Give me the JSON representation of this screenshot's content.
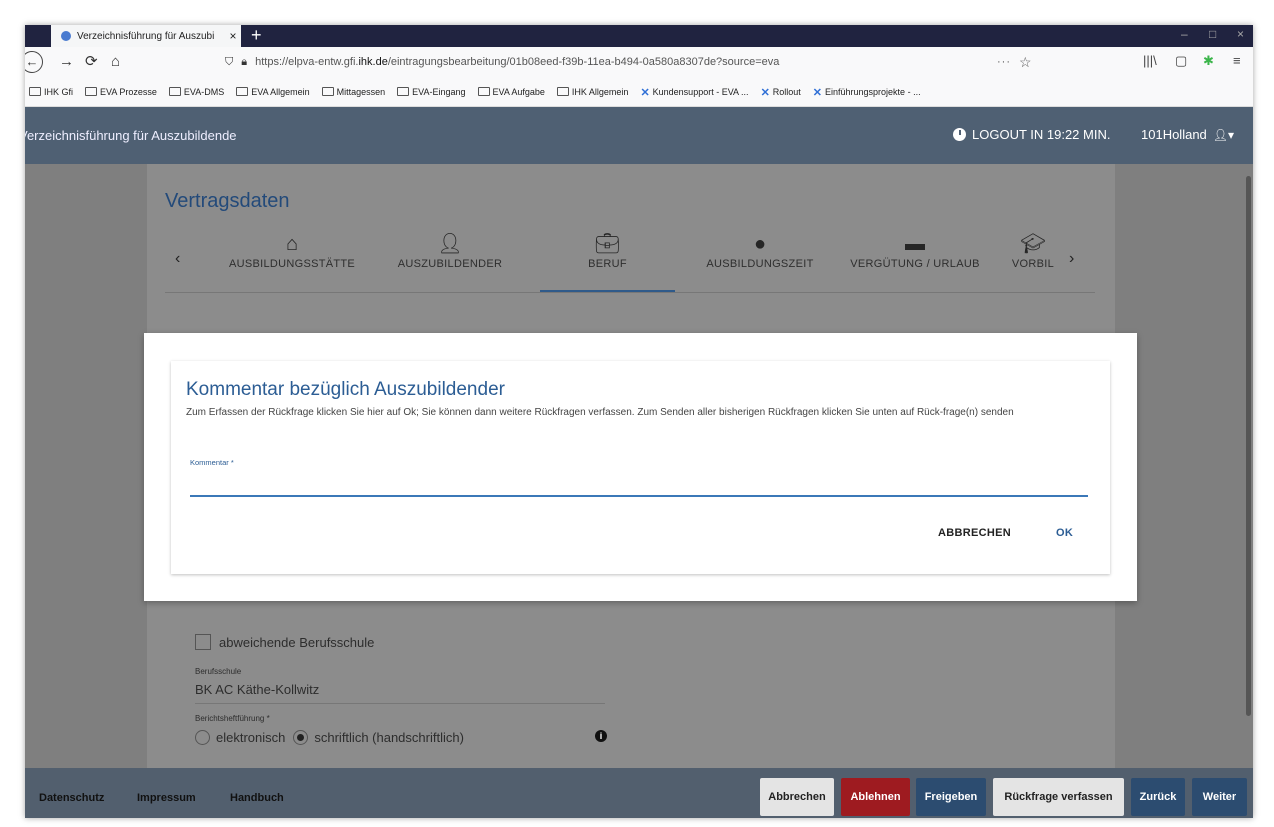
{
  "browser": {
    "tab_title": "Verzeichnisführung für Auszubi",
    "tab_close": "×",
    "new_tab": "+",
    "window_controls": [
      "–",
      "□",
      "×"
    ],
    "url_prefix": "https://elpva-entw.gfi.",
    "url_domain": "ihk.de",
    "url_path": "/eintragungsbearbeitung/01b08eed-f39b-11ea-b494-0a580a8307de?source=eva",
    "url_dots": "···",
    "bookmarks": [
      {
        "label": "IHK Gfi",
        "icon": "folder-icon"
      },
      {
        "label": "EVA Prozesse",
        "icon": "folder-icon"
      },
      {
        "label": "EVA-DMS",
        "icon": "folder-icon"
      },
      {
        "label": "EVA Allgemein",
        "icon": "folder-icon"
      },
      {
        "label": "Mittagessen",
        "icon": "folder-icon"
      },
      {
        "label": "EVA-Eingang",
        "icon": "folder-icon"
      },
      {
        "label": "EVA Aufgabe",
        "icon": "folder-icon"
      },
      {
        "label": "IHK Allgemein",
        "icon": "folder-icon"
      },
      {
        "label": "Kundensupport - EVA ...",
        "icon": "x-logo-icon"
      },
      {
        "label": "Rollout",
        "icon": "x-logo-icon"
      },
      {
        "label": "Einführungsprojekte - ...",
        "icon": "x-logo-icon"
      }
    ]
  },
  "header": {
    "title": "Verzeichnisführung für Auszubildende",
    "logout_text": "LOGOUT IN 19:22 MIN.",
    "username": "101Holland"
  },
  "page": {
    "section_title": "Vertragsdaten",
    "steps": [
      {
        "label": "AUSBILDUNGSSTÄTTE",
        "icon": "home-icon"
      },
      {
        "label": "AUSZUBILDENDER",
        "icon": "person-icon"
      },
      {
        "label": "BERUF",
        "icon": "briefcase-icon",
        "active": true
      },
      {
        "label": "AUSBILDUNGSZEIT",
        "icon": "clock-icon"
      },
      {
        "label": "VERGÜTUNG / URLAUB",
        "icon": "card-icon"
      },
      {
        "label": "VORBIL",
        "icon": "graduation-cap-icon"
      }
    ],
    "checkbox_label": "abweichende Berufsschule",
    "berufsschule_label": "Berufsschule",
    "berufsschule_value": "BK AC Käthe-Kollwitz",
    "bericht_label": "Berichtsheftführung *",
    "radio_options": [
      "elektronisch",
      "schriftlich (handschriftlich)"
    ],
    "radio_selected": "schriftlich (handschriftlich)"
  },
  "modal": {
    "title": "Kommentar bezüglich Auszubildender",
    "description": "Zum Erfassen der Rückfrage klicken Sie hier auf Ok; Sie können dann weitere Rückfragen verfassen. Zum Senden aller bisherigen Rückfragen klicken Sie unten auf Rück-frage(n) senden",
    "field_label": "Kommentar *",
    "field_value": "",
    "cancel_label": "ABBRECHEN",
    "ok_label": "OK"
  },
  "footer": {
    "links": [
      "Datenschutz",
      "Impressum",
      "Handbuch"
    ],
    "buttons": [
      "Abbrechen",
      "Ablehnen",
      "Freigeben",
      "Rückfrage verfassen",
      "Zurück",
      "Weiter"
    ]
  },
  "colors": {
    "header_bg": "#4f6073",
    "accent_blue": "#2c5d94",
    "reject_red": "#9e1b20",
    "button_blue": "#2c4c70"
  }
}
